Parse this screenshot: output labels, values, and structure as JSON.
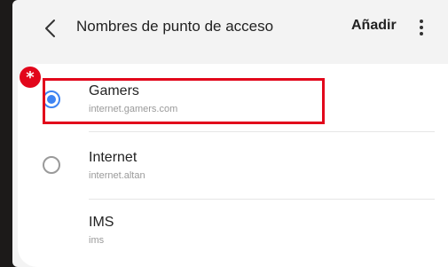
{
  "header": {
    "title": "Nombres de punto de acceso",
    "add_label": "Añadir",
    "back_icon": "chevron-left-icon",
    "more_icon": "more-vertical-icon"
  },
  "apns": [
    {
      "name": "Gamers",
      "apn": "internet.gamers.com",
      "selected": true
    },
    {
      "name": "Internet",
      "apn": "internet.altan",
      "selected": false
    },
    {
      "name": "IMS",
      "apn": "ims",
      "selected": false
    }
  ],
  "annotation": {
    "marker": "*",
    "color": "#e2061b"
  },
  "accent": "#3e84f2"
}
